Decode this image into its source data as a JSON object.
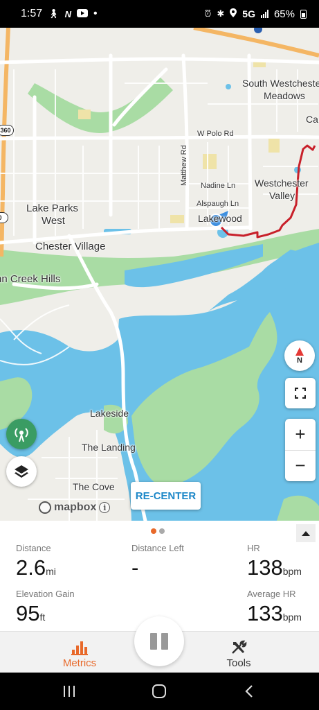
{
  "status_bar": {
    "time": "1:57",
    "network": "5G",
    "battery": "65%",
    "dot": "•"
  },
  "map": {
    "labels": {
      "south_westchester": "South Westchester",
      "meadows": "Meadows",
      "ca": "Ca",
      "w_polo_rd": "W Polo Rd",
      "matthew_rd": "Matthew Rd",
      "nadine_ln": "Nadine Ln",
      "alspaugh_ln": "Alspaugh Ln",
      "westchester": "Westchester",
      "valley": "Valley",
      "lakewood": "Lakewood",
      "lake_parks": "Lake Parks",
      "west": "West",
      "chester_village": "Chester Village",
      "creek_hills": "nn Creek Hills",
      "lakeside": "Lakeside",
      "the_landing": "The Landing",
      "the_cove": "The Cove"
    },
    "shields": {
      "s360": "360",
      "s20": "0"
    },
    "compass_letter": "N",
    "zoom_in": "+",
    "zoom_out": "−",
    "recenter_label": "RE-CENTER",
    "attribution": "mapbox",
    "info": "i"
  },
  "metrics": {
    "distance": {
      "label": "Distance",
      "value": "2.6",
      "unit": "mi"
    },
    "distance_left": {
      "label": "Distance Left",
      "value": "-"
    },
    "hr": {
      "label": "HR",
      "value": "138",
      "unit": "bpm"
    },
    "elevation_gain": {
      "label": "Elevation Gain",
      "value": "95",
      "unit": "ft"
    },
    "average_hr": {
      "label": "Average HR",
      "value": "133",
      "unit": "bpm"
    }
  },
  "nav": {
    "metrics_label": "Metrics",
    "tools_label": "Tools"
  },
  "colors": {
    "accent": "#e8692a",
    "water": "#6cc1e8",
    "park": "#a4d8a0",
    "route": "#c8202a",
    "location": "#3d8fe0"
  }
}
